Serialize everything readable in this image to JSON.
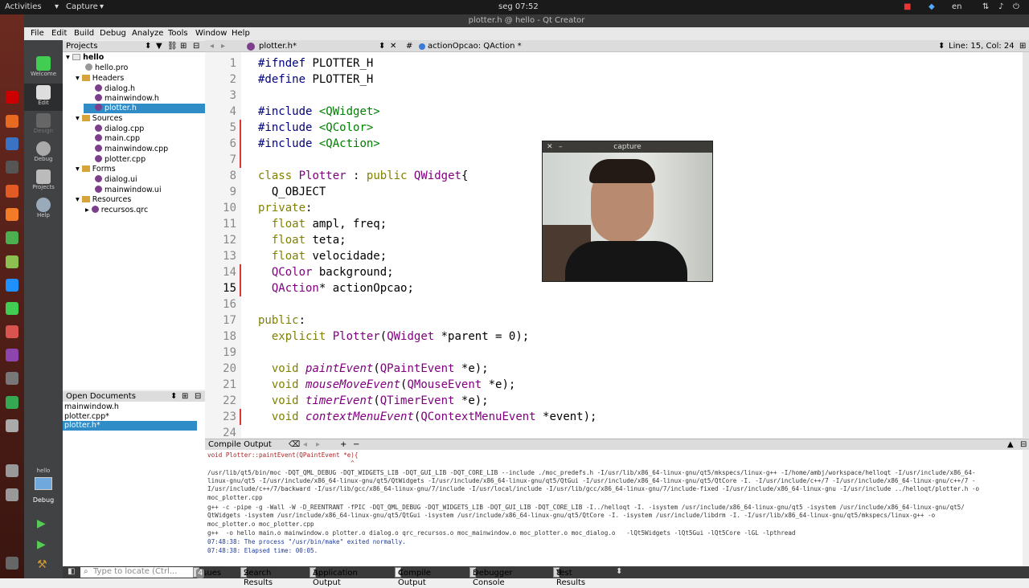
{
  "topbar": {
    "activities": "Activities",
    "app": "Capture",
    "clock": "seg 07:52",
    "lang": "en"
  },
  "window_title": "plotter.h @ hello - Qt Creator",
  "menu": [
    "File",
    "Edit",
    "Build",
    "Debug",
    "Analyze",
    "Tools",
    "Window",
    "Help"
  ],
  "modes": [
    "Welcome",
    "Edit",
    "Design",
    "Debug",
    "Projects",
    "Help"
  ],
  "projects": {
    "header": "Projects",
    "items": [
      {
        "label": "hello",
        "kind": "project"
      },
      {
        "label": "hello.pro",
        "kind": "file"
      },
      {
        "label": "Headers",
        "kind": "folder"
      },
      {
        "label": "dialog.h",
        "kind": "file"
      },
      {
        "label": "mainwindow.h",
        "kind": "file"
      },
      {
        "label": "plotter.h",
        "kind": "file"
      },
      {
        "label": "Sources",
        "kind": "folder"
      },
      {
        "label": "dialog.cpp",
        "kind": "file"
      },
      {
        "label": "main.cpp",
        "kind": "file"
      },
      {
        "label": "mainwindow.cpp",
        "kind": "file"
      },
      {
        "label": "plotter.cpp",
        "kind": "file"
      },
      {
        "label": "Forms",
        "kind": "folder"
      },
      {
        "label": "dialog.ui",
        "kind": "file"
      },
      {
        "label": "mainwindow.ui",
        "kind": "file"
      },
      {
        "label": "Resources",
        "kind": "folder"
      },
      {
        "label": "recursos.qrc",
        "kind": "file"
      }
    ]
  },
  "open_documents": {
    "header": "Open Documents",
    "items": [
      "mainwindow.h",
      "plotter.cpp*",
      "plotter.h*"
    ]
  },
  "editor": {
    "file_tab": "plotter.h*",
    "symbol": "actionOpcao: QAction *",
    "position": "Line: 15, Col: 24"
  },
  "code_lines": [
    {
      "n": "1",
      "t": "#ifndef PLOTTER_H"
    },
    {
      "n": "2",
      "t": "#define PLOTTER_H"
    },
    {
      "n": "3",
      "t": ""
    },
    {
      "n": "4",
      "t": "#include <QWidget>"
    },
    {
      "n": "5",
      "t": "#include <QColor>"
    },
    {
      "n": "6",
      "t": "#include <QAction>"
    },
    {
      "n": "7",
      "t": ""
    },
    {
      "n": "8",
      "t": "class Plotter : public QWidget{"
    },
    {
      "n": "9",
      "t": "  Q_OBJECT"
    },
    {
      "n": "10",
      "t": "private:"
    },
    {
      "n": "11",
      "t": "  float ampl, freq;"
    },
    {
      "n": "12",
      "t": "  float teta;"
    },
    {
      "n": "13",
      "t": "  float velocidade;"
    },
    {
      "n": "14",
      "t": "  QColor background;"
    },
    {
      "n": "15",
      "t": "  QAction* actionOpcao;"
    },
    {
      "n": "16",
      "t": ""
    },
    {
      "n": "17",
      "t": "public:"
    },
    {
      "n": "18",
      "t": "  explicit Plotter(QWidget *parent = 0);"
    },
    {
      "n": "19",
      "t": ""
    },
    {
      "n": "20",
      "t": "  void paintEvent(QPaintEvent *e);"
    },
    {
      "n": "21",
      "t": "  void mouseMoveEvent(QMouseEvent *e);"
    },
    {
      "n": "22",
      "t": "  void timerEvent(QTimerEvent *e);"
    },
    {
      "n": "23",
      "t": "  void contextMenuEvent(QContextMenuEvent *event);"
    },
    {
      "n": "24",
      "t": ""
    }
  ],
  "capture_window": {
    "title": "capture"
  },
  "output": {
    "header": "Compile Output",
    "lines": [
      "void Plotter::paintEvent(QPaintEvent *e){",
      "                                       ^",
      "/usr/lib/qt5/bin/moc -DQT_QML_DEBUG -DQT_WIDGETS_LIB -DQT_GUI_LIB -DQT_CORE_LIB --include ./moc_predefs.h -I/usr/lib/x86_64-linux-gnu/qt5/mkspecs/linux-g++ -I/home/ambj/workspace/helloqt -I/usr/include/x86_64-",
      "linux-gnu/qt5 -I/usr/include/x86_64-linux-gnu/qt5/QtWidgets -I/usr/include/x86_64-linux-gnu/qt5/QtGui -I/usr/include/x86_64-linux-gnu/qt5/QtCore -I. -I/usr/include/c++/7 -I/usr/include/x86_64-linux-gnu/c++/7 -",
      "I/usr/include/c++/7/backward -I/usr/lib/gcc/x86_64-linux-gnu/7/include -I/usr/local/include -I/usr/lib/gcc/x86_64-linux-gnu/7/include-fixed -I/usr/include/x86_64-linux-gnu -I/usr/include ../helloqt/plotter.h -o",
      "moc_plotter.cpp",
      "g++ -c -pipe -g -Wall -W -D_REENTRANT -fPIC -DQT_QML_DEBUG -DQT_WIDGETS_LIB -DQT_GUI_LIB -DQT_CORE_LIB -I../helloqt -I. -isystem /usr/include/x86_64-linux-gnu/qt5 -isystem /usr/include/x86_64-linux-gnu/qt5/",
      "QtWidgets -isystem /usr/include/x86_64-linux-gnu/qt5/QtGui -isystem /usr/include/x86_64-linux-gnu/qt5/QtCore -I. -isystem /usr/include/libdrm -I. -I/usr/lib/x86_64-linux-gnu/qt5/mkspecs/linux-g++ -o",
      "moc_plotter.o moc_plotter.cpp",
      "g++  -o hello main.o mainwindow.o plotter.o dialog.o qrc_recursos.o moc_mainwindow.o moc_plotter.o moc_dialog.o   -lQt5Widgets -lQt5Gui -lQt5Core -lGL -lpthread",
      "07:48:38: The process \"/usr/bin/make\" exited normally.",
      "07:48:38: Elapsed time: 00:05."
    ]
  },
  "statusbar": {
    "locate_placeholder": "Type to locate (Ctrl...",
    "panes": [
      {
        "num": "1",
        "label": "Issues",
        "badge": "4"
      },
      {
        "num": "2",
        "label": "Search Results"
      },
      {
        "num": "3",
        "label": "Application Output"
      },
      {
        "num": "4",
        "label": "Compile Output"
      },
      {
        "num": "5",
        "label": "Debugger Console"
      },
      {
        "num": "8",
        "label": "Test Results"
      }
    ],
    "kit": "hello",
    "kit_mode": "Debug"
  }
}
